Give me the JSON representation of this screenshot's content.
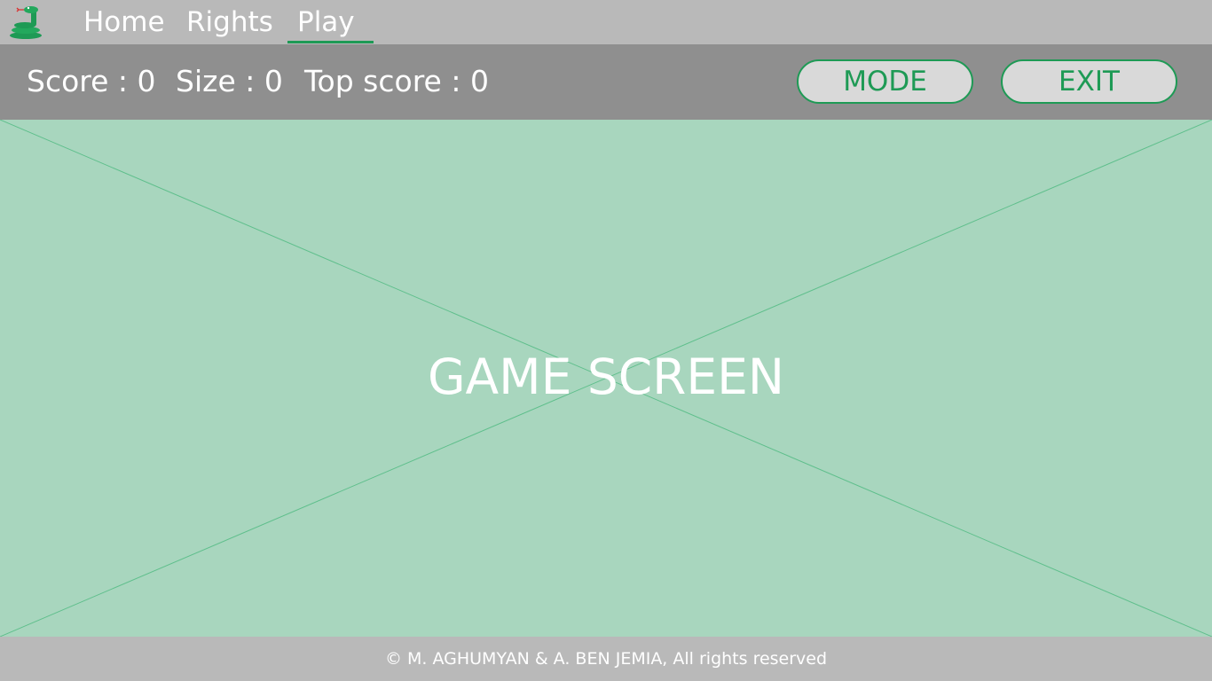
{
  "app": {
    "logo_icon": "snake-icon",
    "accent_color": "#1e9a55"
  },
  "nav": {
    "items": [
      {
        "label": "Home",
        "active": false
      },
      {
        "label": "Rights",
        "active": false
      },
      {
        "label": "Play",
        "active": true
      }
    ]
  },
  "status": {
    "score": "Score : 0",
    "size": "Size : 0",
    "top_score": "Top score : 0"
  },
  "buttons": {
    "mode": "MODE",
    "exit": "EXIT"
  },
  "game": {
    "label": "GAME SCREEN"
  },
  "footer": {
    "text": "© M. AGHUMYAN & A. BEN JEMIA, All rights reserved"
  }
}
